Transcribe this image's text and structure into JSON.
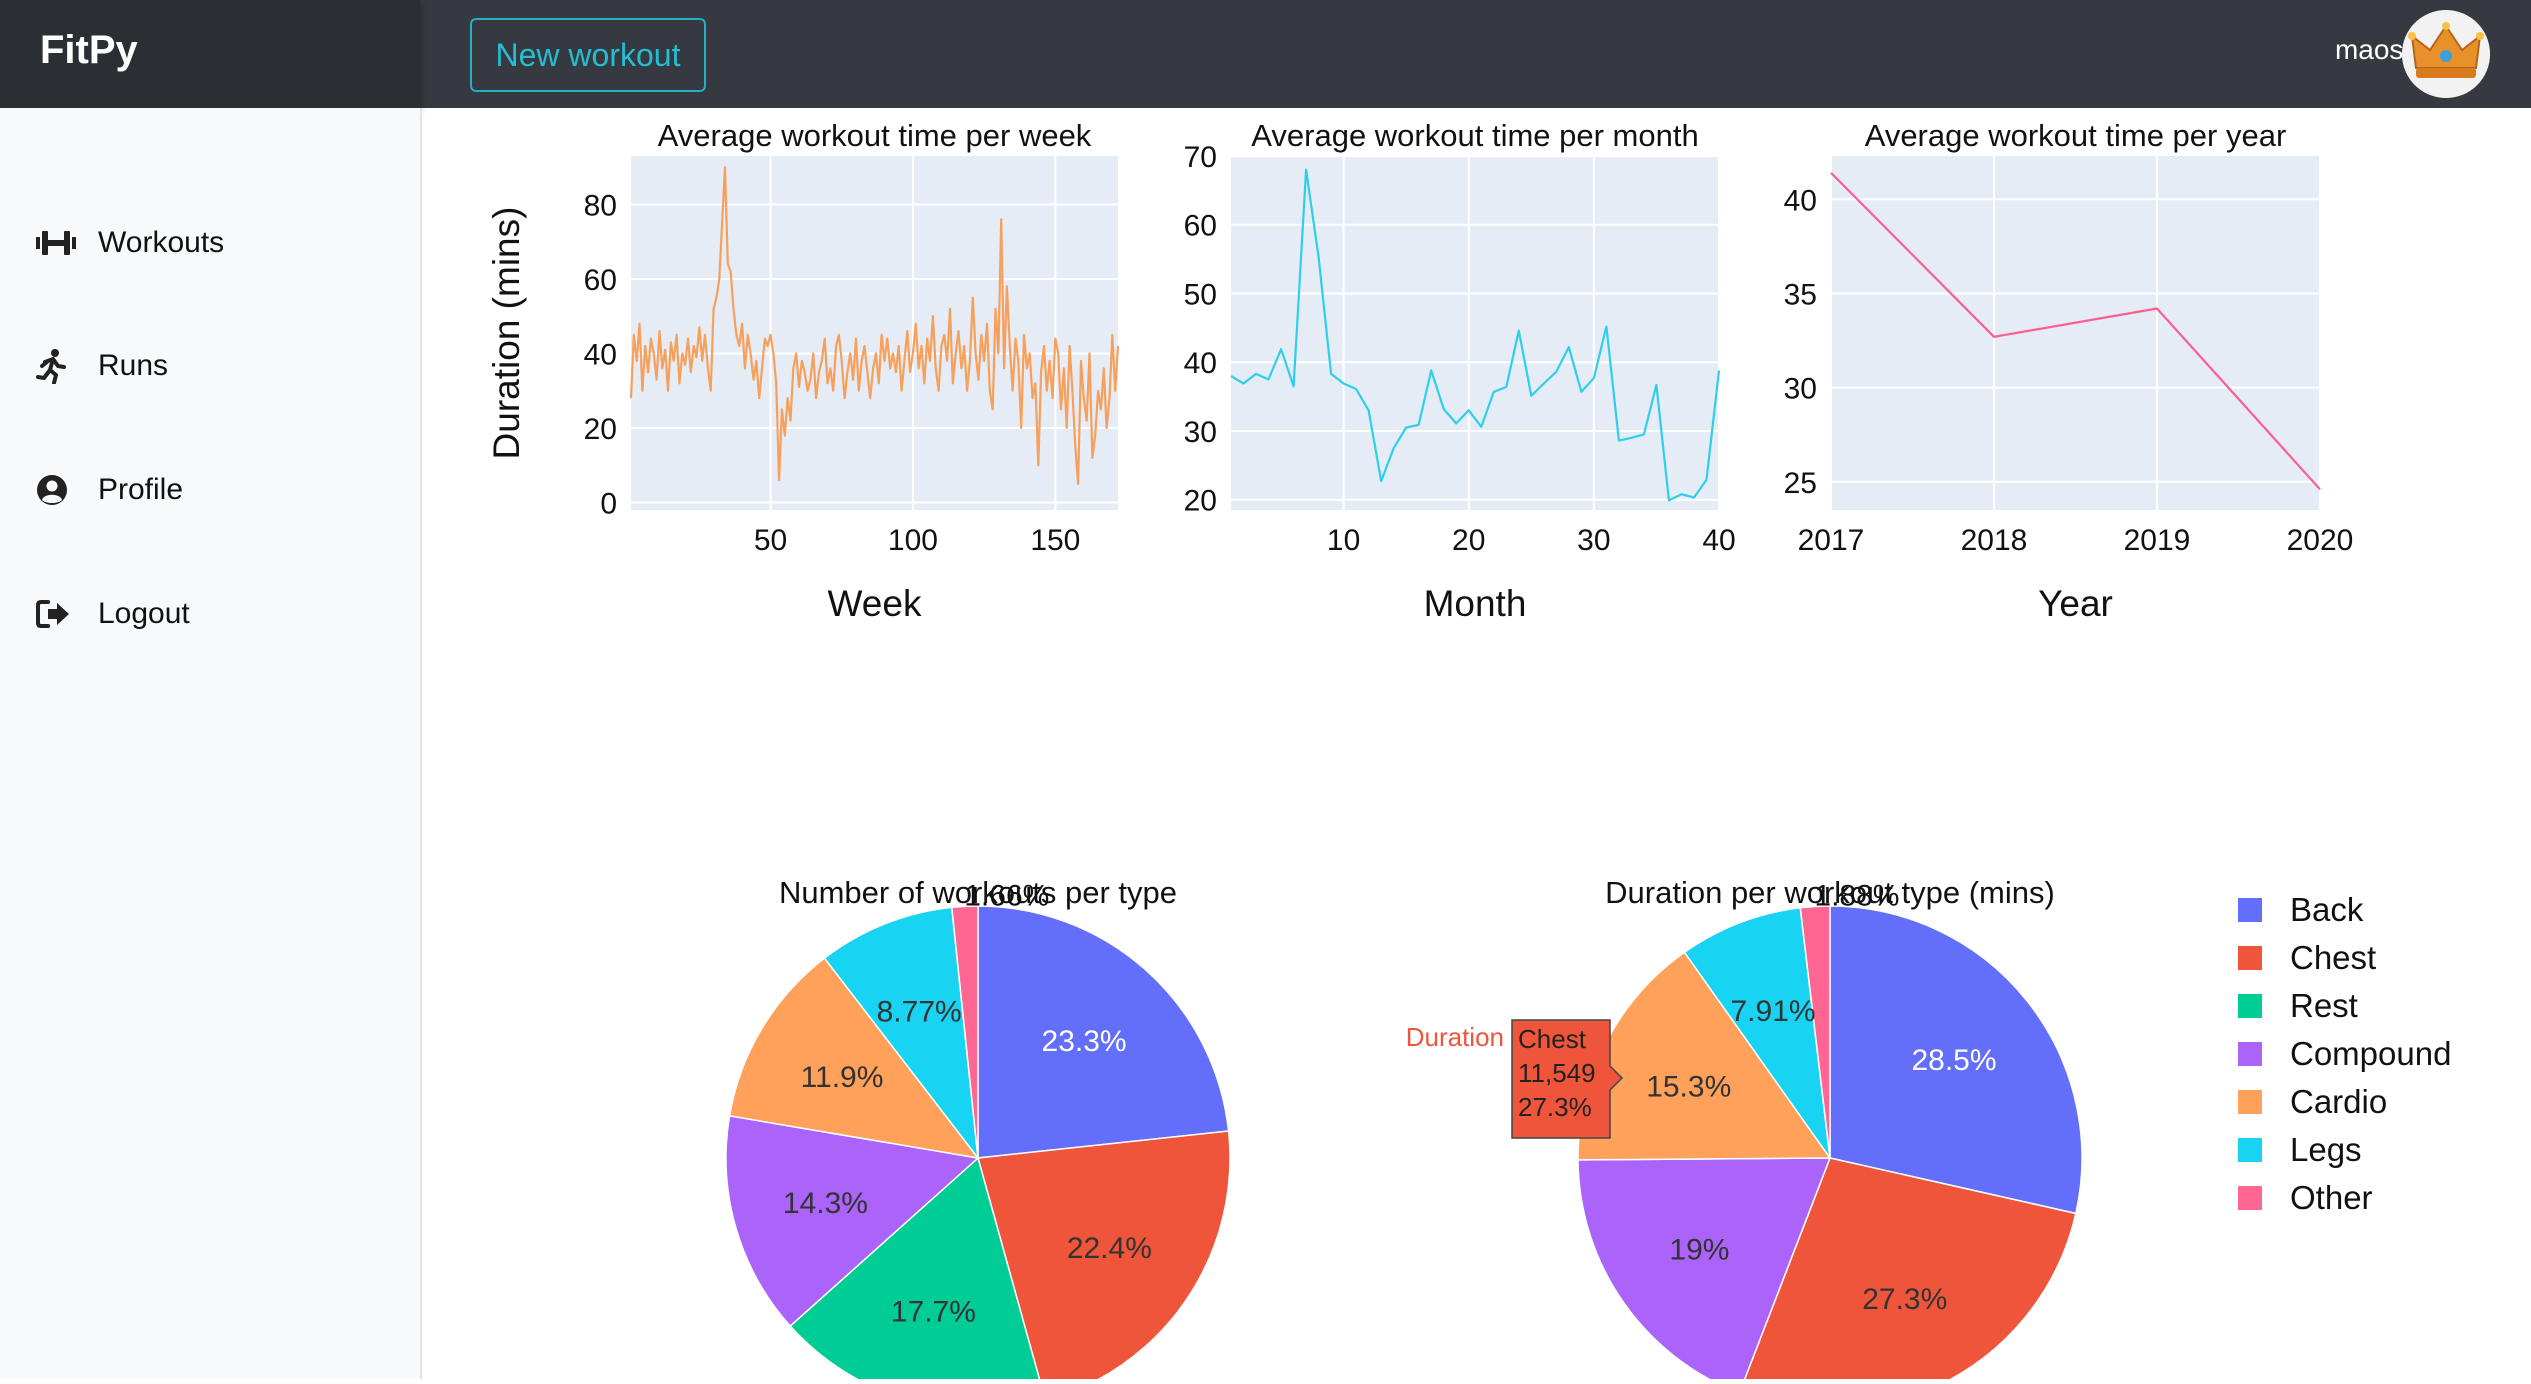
{
  "app": {
    "brand": "FitPy",
    "new_workout_label": "New workout",
    "username": "maosa",
    "avatar_icon": "crown-icon"
  },
  "sidebar": {
    "items": [
      {
        "label": "Workouts",
        "icon": "dumbbell-icon"
      },
      {
        "label": "Runs",
        "icon": "runner-icon"
      },
      {
        "label": "Profile",
        "icon": "user-circle-icon"
      },
      {
        "label": "Logout",
        "icon": "logout-icon"
      }
    ]
  },
  "chart_data": [
    {
      "type": "line",
      "title": "Average workout time per week",
      "xlabel": "Week",
      "ylabel": "Duration (mins)",
      "xlim": [
        1,
        172
      ],
      "ylim": [
        -2,
        93
      ],
      "xticks": [
        50,
        100,
        150
      ],
      "yticks": [
        0,
        20,
        40,
        60,
        80
      ],
      "color": "#f7a05c",
      "series": [
        {
          "x": [
            1,
            2,
            3,
            4,
            5,
            6,
            7,
            8,
            9,
            10,
            11,
            12,
            13,
            14,
            15,
            16,
            17,
            18,
            19,
            20,
            21,
            22,
            23,
            24,
            25,
            26,
            27,
            28,
            29,
            30,
            31,
            32,
            33,
            34,
            35,
            36,
            37,
            38,
            39,
            40,
            41,
            42,
            43,
            44,
            45,
            46,
            47,
            48,
            49,
            50,
            51,
            52,
            53,
            54,
            55,
            56,
            57,
            58,
            59,
            60,
            61,
            62,
            63,
            64,
            65,
            66,
            67,
            68,
            69,
            70,
            71,
            72,
            73,
            74,
            75,
            76,
            77,
            78,
            79,
            80,
            81,
            82,
            83,
            84,
            85,
            86,
            87,
            88,
            89,
            90,
            91,
            92,
            93,
            94,
            95,
            96,
            97,
            98,
            99,
            100,
            101,
            102,
            103,
            104,
            105,
            106,
            107,
            108,
            109,
            110,
            111,
            112,
            113,
            114,
            115,
            116,
            117,
            118,
            119,
            120,
            121,
            122,
            123,
            124,
            125,
            126,
            127,
            128,
            129,
            130,
            131,
            132,
            133,
            134,
            135,
            136,
            137,
            138,
            139,
            140,
            141,
            142,
            143,
            144,
            145,
            146,
            147,
            148,
            149,
            150,
            151,
            152,
            153,
            154,
            155,
            156,
            157,
            158,
            159,
            160,
            161,
            162,
            163,
            164,
            165,
            166,
            167,
            168,
            169,
            170,
            171,
            172
          ],
          "y": [
            28,
            45,
            38,
            48,
            30,
            42,
            35,
            44,
            40,
            33,
            46,
            36,
            41,
            30,
            43,
            38,
            45,
            32,
            40,
            37,
            44,
            35,
            42,
            39,
            47,
            38,
            45,
            36,
            30,
            52,
            55,
            60,
            75,
            90,
            64,
            62,
            52,
            45,
            42,
            48,
            36,
            45,
            40,
            33,
            38,
            28,
            36,
            44,
            42,
            45,
            40,
            32,
            6,
            25,
            18,
            28,
            22,
            36,
            40,
            31,
            38,
            35,
            30,
            33,
            40,
            28,
            35,
            38,
            44,
            32,
            36,
            30,
            42,
            45,
            38,
            28,
            35,
            40,
            33,
            44,
            30,
            38,
            42,
            35,
            28,
            36,
            40,
            32,
            45,
            38,
            44,
            36,
            40,
            35,
            42,
            30,
            38,
            46,
            35,
            40,
            48,
            36,
            42,
            32,
            44,
            38,
            50,
            36,
            30,
            42,
            45,
            38,
            52,
            32,
            40,
            46,
            36,
            42,
            30,
            38,
            55,
            40,
            33,
            45,
            38,
            48,
            30,
            25,
            52,
            40,
            76,
            36,
            58,
            42,
            30,
            44,
            38,
            20,
            45,
            36,
            40,
            28,
            32,
            10,
            35,
            42,
            30,
            38,
            28,
            44,
            40,
            25,
            36,
            20,
            42,
            30,
            15,
            5,
            38,
            28,
            22,
            40,
            12,
            18,
            30,
            25,
            36,
            20,
            28,
            45,
            30,
            42
          ]
        }
      ]
    },
    {
      "type": "line",
      "title": "Average workout time per month",
      "xlabel": "Month",
      "xlim": [
        1,
        40
      ],
      "ylim": [
        18.5,
        70
      ],
      "xticks": [
        10,
        20,
        30,
        40
      ],
      "yticks": [
        20,
        30,
        40,
        50,
        60,
        70
      ],
      "color": "#2ecfea",
      "series": [
        {
          "x": [
            1,
            2,
            3,
            4,
            5,
            6,
            7,
            8,
            9,
            10,
            11,
            12,
            13,
            14,
            15,
            16,
            17,
            18,
            19,
            20,
            21,
            22,
            23,
            24,
            25,
            26,
            27,
            28,
            29,
            30,
            31,
            32,
            33,
            34,
            35,
            36,
            37,
            38,
            39,
            40
          ],
          "y": [
            38,
            36.9,
            38.3,
            37.5,
            41.9,
            36.5,
            68,
            55.3,
            38.3,
            36.9,
            36.1,
            33,
            22.7,
            27.5,
            30.5,
            30.9,
            38.8,
            33.2,
            31.1,
            33,
            30.6,
            35.7,
            36.4,
            44.6,
            35.1,
            36.9,
            38.6,
            42.2,
            35.7,
            37.7,
            45.2,
            28.6,
            29,
            29.5,
            36.7,
            19.9,
            20.8,
            20.3,
            22.9,
            38.8
          ]
        }
      ]
    },
    {
      "type": "line",
      "title": "Average workout time per year",
      "xlabel": "Year",
      "xlim": [
        2017,
        2020
      ],
      "ylim": [
        23.5,
        42.3
      ],
      "xticks": [
        "2017",
        "2018",
        "2019",
        "2020"
      ],
      "yticks": [
        25,
        30,
        35,
        40
      ],
      "color": "#ff5d8f",
      "series": [
        {
          "x": [
            2017,
            2018,
            2019,
            2020
          ],
          "y": [
            41.4,
            32.7,
            34.2,
            24.6
          ]
        }
      ]
    },
    {
      "type": "pie",
      "title": "Number of workouts per type",
      "labels": [
        "Back",
        "Chest",
        "Rest",
        "Compound",
        "Cardio",
        "Legs",
        "Other"
      ],
      "values": [
        23.3,
        22.4,
        17.7,
        14.3,
        11.9,
        8.77,
        1.66
      ],
      "text": [
        "23.3%",
        "22.4%",
        "17.7%",
        "14.3%",
        "11.9%",
        "8.77%",
        "1.66%"
      ]
    },
    {
      "type": "pie",
      "title": "Duration per workout type (mins)",
      "labels": [
        "Back",
        "Chest",
        "Compound",
        "Cardio",
        "Legs",
        "Other"
      ],
      "values": [
        28.5,
        27.3,
        19,
        15.3,
        7.91,
        1.88
      ],
      "text": [
        "28.5%",
        "27.3%",
        "19%",
        "15.3%",
        "7.91%",
        "1.88%"
      ],
      "hover": {
        "series": "Duration",
        "label": "Chest",
        "value": "11,549",
        "percent": "27.3%"
      }
    }
  ],
  "legend": {
    "items": [
      {
        "label": "Back",
        "color": "#636efa"
      },
      {
        "label": "Chest",
        "color": "#ef553b"
      },
      {
        "label": "Rest",
        "color": "#00cc96"
      },
      {
        "label": "Compound",
        "color": "#ab63fa"
      },
      {
        "label": "Cardio",
        "color": "#ffa15a"
      },
      {
        "label": "Legs",
        "color": "#19d3f3"
      },
      {
        "label": "Other",
        "color": "#ff6692"
      }
    ]
  }
}
